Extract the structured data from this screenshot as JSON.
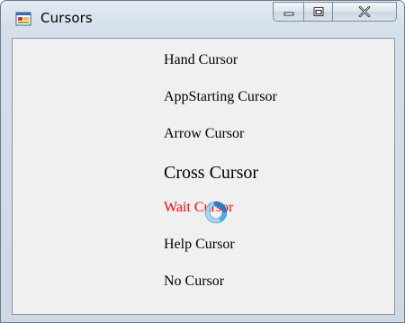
{
  "window": {
    "title": "Cursors",
    "icon": "form-icon"
  },
  "caption": {
    "minimize_icon": "minimize-icon",
    "maximize_icon": "maximize-icon",
    "close_icon": "close-icon"
  },
  "labels": [
    {
      "text": "Hand Cursor"
    },
    {
      "text": "AppStarting Cursor"
    },
    {
      "text": "Arrow Cursor"
    },
    {
      "text": "Cross Cursor"
    },
    {
      "text": "Wait Cursor",
      "color": "#ff0000"
    },
    {
      "text": "Help Cursor"
    },
    {
      "text": "No Cursor"
    }
  ],
  "pointer": {
    "icon": "busy-spinner-icon"
  }
}
